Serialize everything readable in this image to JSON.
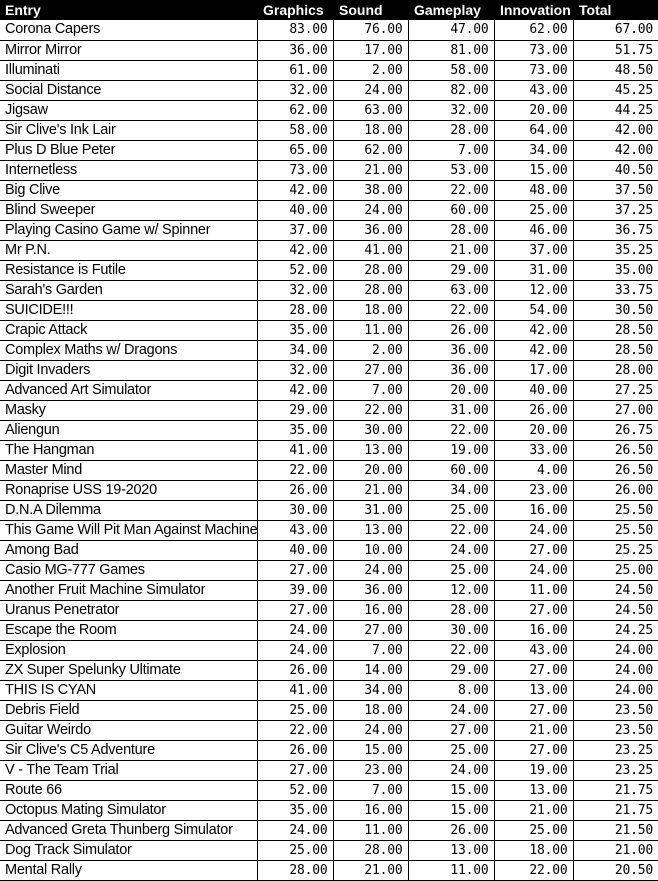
{
  "table": {
    "columns": [
      {
        "key": "entry",
        "label": "Entry"
      },
      {
        "key": "graphics",
        "label": "Graphics"
      },
      {
        "key": "sound",
        "label": "Sound"
      },
      {
        "key": "gameplay",
        "label": "Gameplay"
      },
      {
        "key": "innovation",
        "label": "Innovation"
      },
      {
        "key": "total",
        "label": "Total"
      }
    ],
    "header_bg": "#000000",
    "header_fg": "#ffffff",
    "grid_color": "#000000",
    "rows": [
      {
        "entry": "Corona Capers",
        "graphics": "83.00",
        "sound": "76.00",
        "gameplay": "47.00",
        "innovation": "62.00",
        "total": "67.00"
      },
      {
        "entry": "Mirror Mirror",
        "graphics": "36.00",
        "sound": "17.00",
        "gameplay": "81.00",
        "innovation": "73.00",
        "total": "51.75"
      },
      {
        "entry": "Illuminati",
        "graphics": "61.00",
        "sound": "2.00",
        "gameplay": "58.00",
        "innovation": "73.00",
        "total": "48.50"
      },
      {
        "entry": "Social Distance",
        "graphics": "32.00",
        "sound": "24.00",
        "gameplay": "82.00",
        "innovation": "43.00",
        "total": "45.25"
      },
      {
        "entry": "Jigsaw",
        "graphics": "62.00",
        "sound": "63.00",
        "gameplay": "32.00",
        "innovation": "20.00",
        "total": "44.25"
      },
      {
        "entry": "Sir Clive's Ink Lair",
        "graphics": "58.00",
        "sound": "18.00",
        "gameplay": "28.00",
        "innovation": "64.00",
        "total": "42.00"
      },
      {
        "entry": "Plus D Blue Peter",
        "graphics": "65.00",
        "sound": "62.00",
        "gameplay": "7.00",
        "innovation": "34.00",
        "total": "42.00"
      },
      {
        "entry": "Internetless",
        "graphics": "73.00",
        "sound": "21.00",
        "gameplay": "53.00",
        "innovation": "15.00",
        "total": "40.50"
      },
      {
        "entry": "Big Clive",
        "graphics": "42.00",
        "sound": "38.00",
        "gameplay": "22.00",
        "innovation": "48.00",
        "total": "37.50"
      },
      {
        "entry": "Blind Sweeper",
        "graphics": "40.00",
        "sound": "24.00",
        "gameplay": "60.00",
        "innovation": "25.00",
        "total": "37.25"
      },
      {
        "entry": "Playing Casino Game w/ Spinner",
        "graphics": "37.00",
        "sound": "36.00",
        "gameplay": "28.00",
        "innovation": "46.00",
        "total": "36.75"
      },
      {
        "entry": "Mr P.N.",
        "graphics": "42.00",
        "sound": "41.00",
        "gameplay": "21.00",
        "innovation": "37.00",
        "total": "35.25"
      },
      {
        "entry": "Resistance is Futile",
        "graphics": "52.00",
        "sound": "28.00",
        "gameplay": "29.00",
        "innovation": "31.00",
        "total": "35.00"
      },
      {
        "entry": "Sarah's Garden",
        "graphics": "32.00",
        "sound": "28.00",
        "gameplay": "63.00",
        "innovation": "12.00",
        "total": "33.75"
      },
      {
        "entry": "SUICIDE!!!",
        "graphics": "28.00",
        "sound": "18.00",
        "gameplay": "22.00",
        "innovation": "54.00",
        "total": "30.50"
      },
      {
        "entry": "Crapic Attack",
        "graphics": "35.00",
        "sound": "11.00",
        "gameplay": "26.00",
        "innovation": "42.00",
        "total": "28.50"
      },
      {
        "entry": "Complex Maths w/ Dragons",
        "graphics": "34.00",
        "sound": "2.00",
        "gameplay": "36.00",
        "innovation": "42.00",
        "total": "28.50"
      },
      {
        "entry": "Digit Invaders",
        "graphics": "32.00",
        "sound": "27.00",
        "gameplay": "36.00",
        "innovation": "17.00",
        "total": "28.00"
      },
      {
        "entry": "Advanced Art Simulator",
        "graphics": "42.00",
        "sound": "7.00",
        "gameplay": "20.00",
        "innovation": "40.00",
        "total": "27.25"
      },
      {
        "entry": "Masky",
        "graphics": "29.00",
        "sound": "22.00",
        "gameplay": "31.00",
        "innovation": "26.00",
        "total": "27.00"
      },
      {
        "entry": "Aliengun",
        "graphics": "35.00",
        "sound": "30.00",
        "gameplay": "22.00",
        "innovation": "20.00",
        "total": "26.75"
      },
      {
        "entry": "The Hangman",
        "graphics": "41.00",
        "sound": "13.00",
        "gameplay": "19.00",
        "innovation": "33.00",
        "total": "26.50"
      },
      {
        "entry": "Master Mind",
        "graphics": "22.00",
        "sound": "20.00",
        "gameplay": "60.00",
        "innovation": "4.00",
        "total": "26.50"
      },
      {
        "entry": "Ronaprise USS 19-2020",
        "graphics": "26.00",
        "sound": "21.00",
        "gameplay": "34.00",
        "innovation": "23.00",
        "total": "26.00"
      },
      {
        "entry": "D.N.A Dilemma",
        "graphics": "30.00",
        "sound": "31.00",
        "gameplay": "25.00",
        "innovation": "16.00",
        "total": "25.50"
      },
      {
        "entry": "This Game Will Pit Man Against Machine",
        "graphics": "43.00",
        "sound": "13.00",
        "gameplay": "22.00",
        "innovation": "24.00",
        "total": "25.50"
      },
      {
        "entry": "Among Bad",
        "graphics": "40.00",
        "sound": "10.00",
        "gameplay": "24.00",
        "innovation": "27.00",
        "total": "25.25"
      },
      {
        "entry": "Casio MG-777 Games",
        "graphics": "27.00",
        "sound": "24.00",
        "gameplay": "25.00",
        "innovation": "24.00",
        "total": "25.00"
      },
      {
        "entry": "Another Fruit Machine Simulator",
        "graphics": "39.00",
        "sound": "36.00",
        "gameplay": "12.00",
        "innovation": "11.00",
        "total": "24.50"
      },
      {
        "entry": "Uranus Penetrator",
        "graphics": "27.00",
        "sound": "16.00",
        "gameplay": "28.00",
        "innovation": "27.00",
        "total": "24.50"
      },
      {
        "entry": "Escape the Room",
        "graphics": "24.00",
        "sound": "27.00",
        "gameplay": "30.00",
        "innovation": "16.00",
        "total": "24.25"
      },
      {
        "entry": "Explosion",
        "graphics": "24.00",
        "sound": "7.00",
        "gameplay": "22.00",
        "innovation": "43.00",
        "total": "24.00"
      },
      {
        "entry": "ZX Super Spelunky Ultimate",
        "graphics": "26.00",
        "sound": "14.00",
        "gameplay": "29.00",
        "innovation": "27.00",
        "total": "24.00"
      },
      {
        "entry": "THIS IS CYAN",
        "graphics": "41.00",
        "sound": "34.00",
        "gameplay": "8.00",
        "innovation": "13.00",
        "total": "24.00"
      },
      {
        "entry": "Debris Field",
        "graphics": "25.00",
        "sound": "18.00",
        "gameplay": "24.00",
        "innovation": "27.00",
        "total": "23.50"
      },
      {
        "entry": "Guitar Weirdo",
        "graphics": "22.00",
        "sound": "24.00",
        "gameplay": "27.00",
        "innovation": "21.00",
        "total": "23.50"
      },
      {
        "entry": "Sir Clive's C5 Adventure",
        "graphics": "26.00",
        "sound": "15.00",
        "gameplay": "25.00",
        "innovation": "27.00",
        "total": "23.25"
      },
      {
        "entry": "V - The Team Trial",
        "graphics": "27.00",
        "sound": "23.00",
        "gameplay": "24.00",
        "innovation": "19.00",
        "total": "23.25"
      },
      {
        "entry": "Route 66",
        "graphics": "52.00",
        "sound": "7.00",
        "gameplay": "15.00",
        "innovation": "13.00",
        "total": "21.75"
      },
      {
        "entry": "Octopus Mating Simulator",
        "graphics": "35.00",
        "sound": "16.00",
        "gameplay": "15.00",
        "innovation": "21.00",
        "total": "21.75"
      },
      {
        "entry": "Advanced Greta Thunberg Simulator",
        "graphics": "24.00",
        "sound": "11.00",
        "gameplay": "26.00",
        "innovation": "25.00",
        "total": "21.50"
      },
      {
        "entry": "Dog Track Simulator",
        "graphics": "25.00",
        "sound": "28.00",
        "gameplay": "13.00",
        "innovation": "18.00",
        "total": "21.00"
      },
      {
        "entry": "Mental Rally",
        "graphics": "28.00",
        "sound": "21.00",
        "gameplay": "11.00",
        "innovation": "22.00",
        "total": "20.50"
      }
    ]
  }
}
